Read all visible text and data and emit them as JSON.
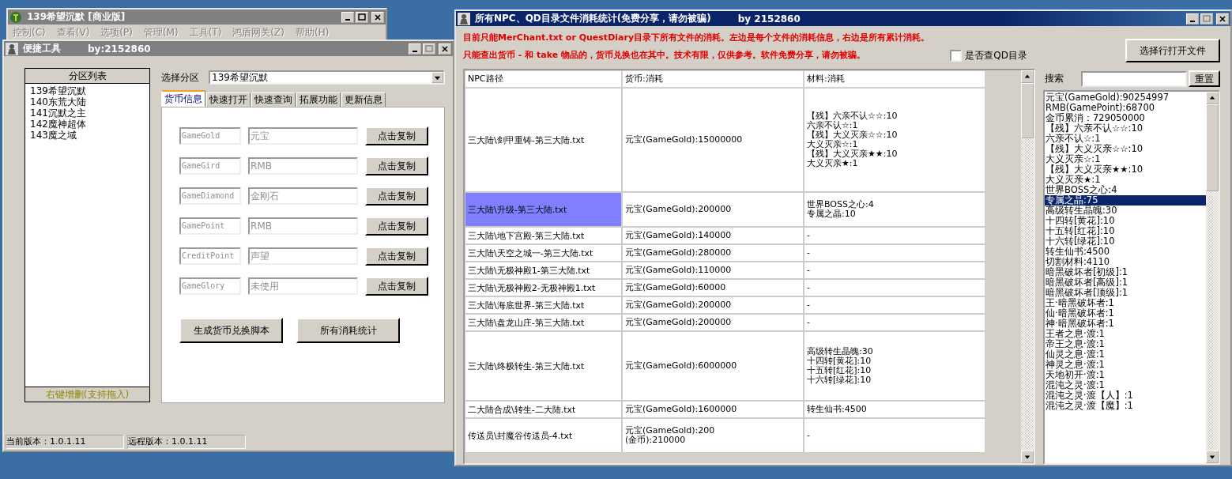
{
  "back_window": {
    "title": "139希望沉默 [商业版]",
    "menu": [
      {
        "label": "控制(C)",
        "disabled": true
      },
      {
        "label": "查看(V)",
        "disabled": true
      },
      {
        "label": "选项(P)",
        "disabled": true
      },
      {
        "label": "管理(M)",
        "disabled": true
      },
      {
        "label": "工具(T)",
        "disabled": true
      },
      {
        "label": "鸿盾网关(Z)",
        "disabled": true
      },
      {
        "label": "帮助(H)",
        "disabled": true
      }
    ]
  },
  "tool_window": {
    "title": "便捷工具",
    "author": "by:2152860",
    "zone_list": {
      "header": "分区列表",
      "items": [
        "139希望沉默",
        "140东荒大陆",
        "141沉默之主",
        "142魔神超体",
        "143魔之域"
      ],
      "footer": "右键增删(支持拖入)"
    },
    "zone_select": {
      "label": "选择分区",
      "value": "139希望沉默"
    },
    "tabs": [
      {
        "label": "货币信息",
        "selected": true
      },
      {
        "label": "快速打开",
        "selected": false
      },
      {
        "label": "快速查询",
        "selected": false
      },
      {
        "label": "拓展功能",
        "selected": false
      },
      {
        "label": "更新信息",
        "selected": false
      }
    ],
    "currencies": [
      {
        "key": "GameGold",
        "name": "元宝",
        "button": "点击复制",
        "disabled": true
      },
      {
        "key": "GameGird",
        "name": "RMB",
        "button": "点击复制",
        "disabled": true
      },
      {
        "key": "GameDiamond",
        "name": "金刚石",
        "button": "点击复制",
        "disabled": true
      },
      {
        "key": "GamePoint",
        "name": "RMB",
        "button": "点击复制",
        "disabled": true
      },
      {
        "key": "CreditPoint",
        "name": "声望",
        "button": "点击复制",
        "disabled": true
      },
      {
        "key": "GameGlory",
        "name": "未使用",
        "button": "点击复制",
        "disabled": true
      }
    ],
    "actions": [
      "生成货币兑换脚本",
      "所有消耗统计"
    ],
    "status_bar": [
      "当前版本：1.0.1.11",
      "远程版本：1.0.1.11"
    ]
  },
  "stats_window": {
    "title": "所有NPC、QD目录文件消耗统计(免费分享，请勿被骗)",
    "author": "by 2152860",
    "notices": [
      "目前只能MerChant.txt or QuestDiary目录下所有文件的消耗。左边是每个文件的消耗信息，右边是所有累计消耗。",
      "只能查出货币 - 和 take 物品的，货币兑换也在其中。技术有限，仅供参考。软件免费分享，请勿被骗。"
    ],
    "qd_checkbox": {
      "label": "是否查QD目录",
      "checked": false
    },
    "open_button": "选择行打开文件",
    "search": {
      "label": "搜索",
      "button": "重置"
    },
    "table": {
      "columns": [
        "NPC路径",
        "货币:消耗",
        "材料:消耗"
      ],
      "rows": [
        {
          "path": "三大陆\\剑甲重铸-第三大陆.txt",
          "currency": [
            "元宝(GameGold):15000000"
          ],
          "materials": [
            "【残】六亲不认☆☆:10",
            "六亲不认☆:1",
            "【残】大义灭亲☆☆:10",
            "大义灭亲☆:1",
            "【残】大义灭亲★★:10",
            "大义灭亲★:1"
          ],
          "selected": false
        },
        {
          "path": "三大陆\\升级-第三大陆.txt",
          "currency": [
            "元宝(GameGold):200000"
          ],
          "materials": [
            "世界BOSS之心:4",
            "专属之晶:10"
          ],
          "selected": true
        },
        {
          "path": "三大陆\\地下宫殿-第三大陆.txt",
          "currency": [
            "元宝(GameGold):140000"
          ],
          "materials": [
            "-"
          ],
          "selected": false
        },
        {
          "path": "三大陆\\天空之城一-第三大陆.txt",
          "currency": [
            "元宝(GameGold):280000"
          ],
          "materials": [
            "-"
          ],
          "selected": false
        },
        {
          "path": "三大陆\\无极神殿1-第三大陆.txt",
          "currency": [
            "元宝(GameGold):110000"
          ],
          "materials": [
            "-"
          ],
          "selected": false
        },
        {
          "path": "三大陆\\无极神殿2-无极神殿1.txt",
          "currency": [
            "元宝(GameGold):60000"
          ],
          "materials": [
            "-"
          ],
          "selected": false
        },
        {
          "path": "三大陆\\海底世界-第三大陆.txt",
          "currency": [
            "元宝(GameGold):200000"
          ],
          "materials": [
            "-"
          ],
          "selected": false
        },
        {
          "path": "三大陆\\盘龙山庄-第三大陆.txt",
          "currency": [
            "元宝(GameGold):200000"
          ],
          "materials": [
            "-"
          ],
          "selected": false
        },
        {
          "path": "三大陆\\终极转生-第三大陆.txt",
          "currency": [
            "元宝(GameGold):6000000"
          ],
          "materials": [
            "高级转生晶魄:30",
            "十四转[黄花]:10",
            "十五转[红花]:10",
            "十六转[绿花]:10"
          ],
          "selected": false
        },
        {
          "path": "二大陆合成\\转生-二大陆.txt",
          "currency": [
            "元宝(GameGold):1600000"
          ],
          "materials": [
            "转生仙书:4500"
          ],
          "selected": false
        },
        {
          "path": "传送员\\封魔谷传送员-4.txt",
          "currency": [
            "元宝(GameGold):200",
            "(金币):210000"
          ],
          "materials": [
            "-"
          ],
          "selected": false
        }
      ]
    },
    "totals": [
      {
        "text": "元宝(GameGold):90254997",
        "selected": false
      },
      {
        "text": "RMB(GamePoint):68700",
        "selected": false
      },
      {
        "text": "金币累消：729050000",
        "selected": false
      },
      {
        "text": "【残】六亲不认☆☆:10",
        "selected": false
      },
      {
        "text": "六亲不认☆:1",
        "selected": false
      },
      {
        "text": "【残】大义灭亲☆☆:10",
        "selected": false
      },
      {
        "text": "大义灭亲☆:1",
        "selected": false
      },
      {
        "text": "【残】大义灭亲★★:10",
        "selected": false
      },
      {
        "text": "大义灭亲★:1",
        "selected": false
      },
      {
        "text": "世界BOSS之心:4",
        "selected": false
      },
      {
        "text": "专属之晶:75",
        "selected": true
      },
      {
        "text": "高级转生晶魄:30",
        "selected": false
      },
      {
        "text": "十四转[黄花]:10",
        "selected": false
      },
      {
        "text": "十五转[红花]:10",
        "selected": false
      },
      {
        "text": "十六转[绿花]:10",
        "selected": false
      },
      {
        "text": "转生仙书:4500",
        "selected": false
      },
      {
        "text": "切割材料:4110",
        "selected": false
      },
      {
        "text": "暗黑破坏者[初级]:1",
        "selected": false
      },
      {
        "text": "暗黑破坏者[高级]:1",
        "selected": false
      },
      {
        "text": "暗黑破坏者[顶级]:1",
        "selected": false
      },
      {
        "text": "王·暗黑破坏者:1",
        "selected": false
      },
      {
        "text": "仙·暗黑破坏者:1",
        "selected": false
      },
      {
        "text": "神·暗黑破坏者:1",
        "selected": false
      },
      {
        "text": "王者之息·渡:1",
        "selected": false
      },
      {
        "text": "帝王之息·渡:1",
        "selected": false
      },
      {
        "text": "仙灵之息·渡:1",
        "selected": false
      },
      {
        "text": "神灵之息·渡:1",
        "selected": false
      },
      {
        "text": "天地初开·渡:1",
        "selected": false
      },
      {
        "text": "混沌之灵·渡:1",
        "selected": false
      },
      {
        "text": "混沌之灵·渡【人】:1",
        "selected": false
      },
      {
        "text": "混沌之灵·渡【魔】:1",
        "selected": false
      }
    ]
  }
}
